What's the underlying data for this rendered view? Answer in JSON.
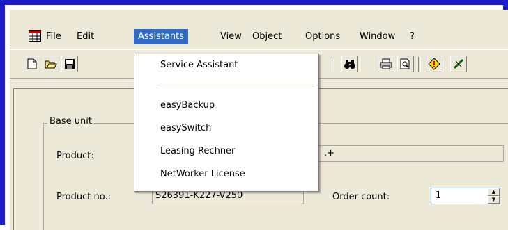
{
  "menubar": {
    "items": [
      {
        "label": "File"
      },
      {
        "label": "Edit"
      },
      {
        "label": "Assistants"
      },
      {
        "label": "View"
      },
      {
        "label": "Object"
      },
      {
        "label": "Options"
      },
      {
        "label": "Window"
      },
      {
        "label": "?"
      }
    ],
    "active": "Assistants"
  },
  "toolbar": {
    "buttons": [
      "new-file-icon",
      "open-folder-icon",
      "save-disk-icon",
      "find-binoculars-icon",
      "print-icon",
      "print-preview-icon",
      "warning-diamond-icon",
      "ruler-icon"
    ]
  },
  "assistants_menu": {
    "items": [
      {
        "label": "Service Assistant"
      },
      {
        "label": "easyBackup"
      },
      {
        "label": "easySwitch"
      },
      {
        "label": "Leasing Rechner"
      },
      {
        "label": "NetWorker License"
      }
    ]
  },
  "form": {
    "group_title": "Base unit",
    "product_label": "Product:",
    "product_value_visible": ".+",
    "product_no_label": "Product no.:",
    "product_no_value": "S26391-K227-V250",
    "order_count_label": "Order count:",
    "order_count_value": "1"
  },
  "colors": {
    "frame_border": "#1c1cc8",
    "menu_highlight": "#316ac5",
    "window_bg": "#ece9d8"
  }
}
